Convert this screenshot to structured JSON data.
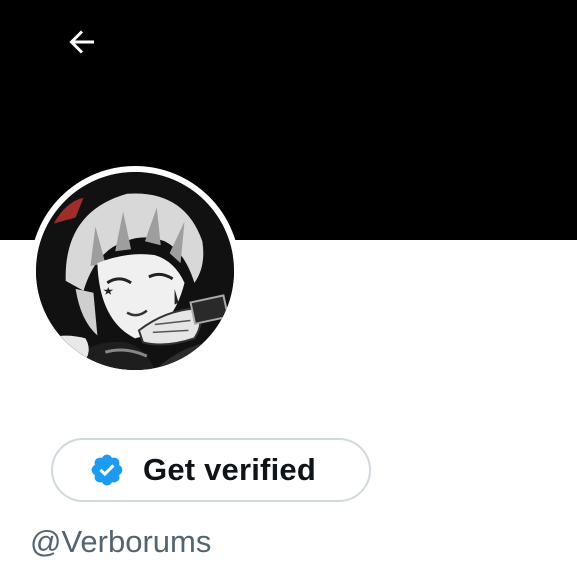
{
  "header": {
    "back_icon": "arrow-left-icon",
    "banner_color": "#000000"
  },
  "profile": {
    "avatar_description_icon": "avatar-image",
    "verify_button_label": "Get verified",
    "verify_icon": "verified-badge-icon",
    "verify_color": "#1d9bf0",
    "handle": "@Verborums"
  }
}
